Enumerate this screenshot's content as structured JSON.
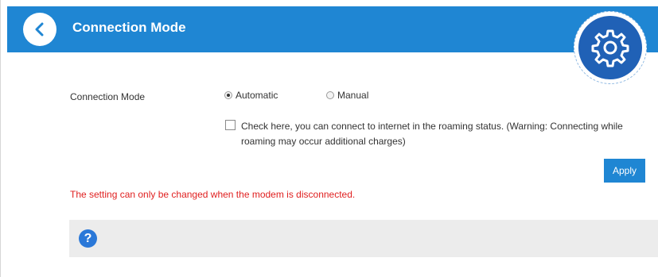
{
  "header": {
    "title": "Connection Mode",
    "back_icon": "chevron-left-icon",
    "badge_icon": "gear-icon"
  },
  "connection_mode": {
    "label": "Connection Mode",
    "options": [
      {
        "label": "Automatic",
        "selected": true
      },
      {
        "label": "Manual",
        "selected": false
      }
    ]
  },
  "roaming": {
    "checked": false,
    "text": "Check here, you can connect to internet in the roaming status. (Warning: Connecting while roaming may occur additional charges)"
  },
  "apply_label": "Apply",
  "warning_text": "The setting can only be changed when the modem is disconnected.",
  "help": {
    "icon": "help-icon",
    "glyph": "?"
  },
  "colors": {
    "primary": "#1f86d3",
    "badge": "#2061b6",
    "warning": "#e02020",
    "help_bar": "#ececec"
  }
}
